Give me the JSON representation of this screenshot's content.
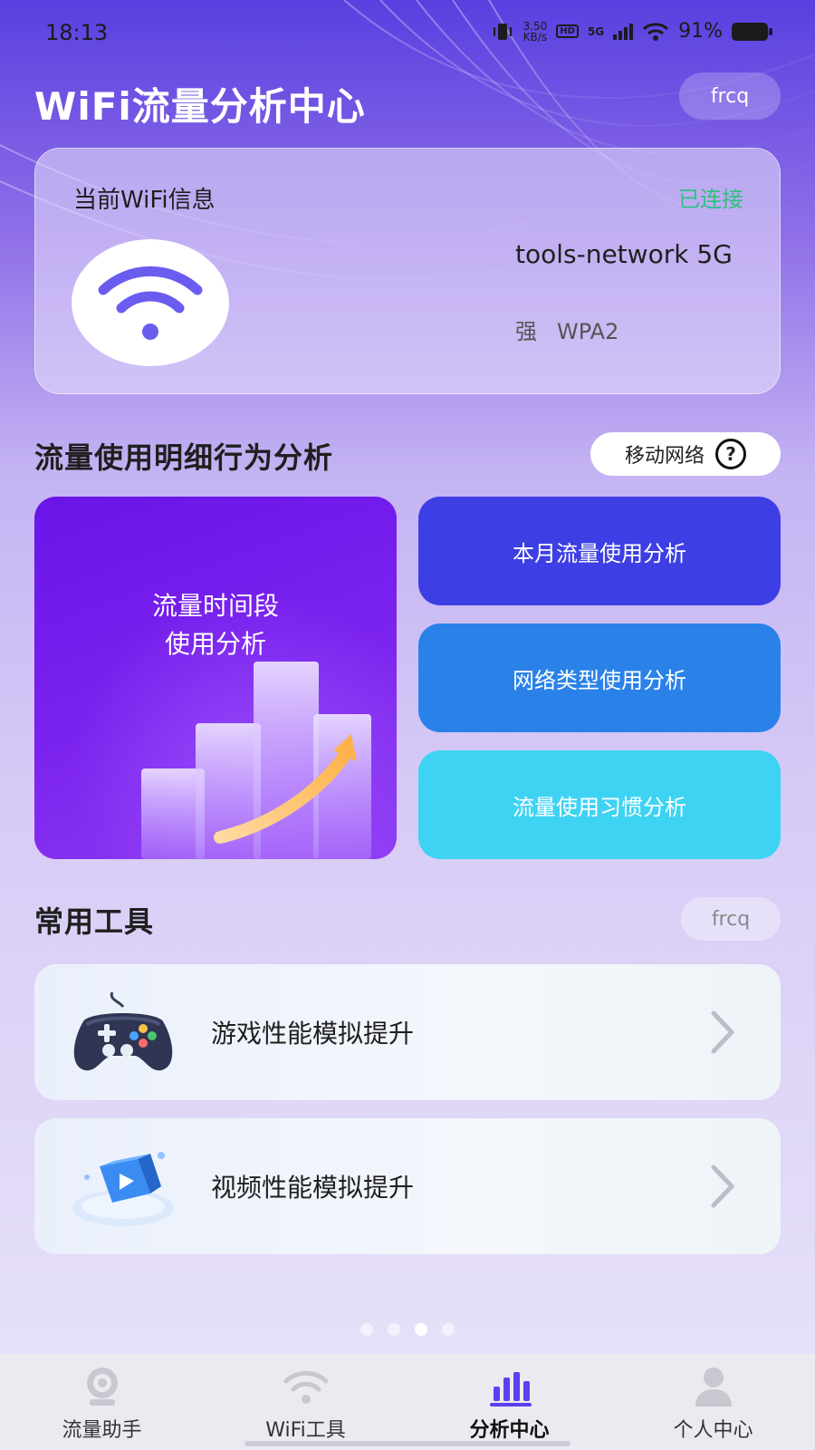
{
  "status_bar": {
    "time": "18:13",
    "speed_value": "3.50",
    "speed_unit": "KB/s",
    "hd_tag": "HD",
    "network_tag": "5G",
    "battery": "91%"
  },
  "header": {
    "title": "WiFi流量分析中心",
    "pill": "frcq"
  },
  "wifi_card": {
    "title": "当前WiFi信息",
    "status": "已连接",
    "status_color": "#2ec27e",
    "ssid": "tools-network 5G",
    "signal": "强",
    "security": "WPA2",
    "icon": "wifi-icon"
  },
  "analysis": {
    "title": "流量使用明细行为分析",
    "network_selector": "移动网络",
    "help_icon": "question-icon",
    "big_tile_label_line1": "流量时间段",
    "big_tile_label_line2": "使用分析",
    "tiles": [
      {
        "label": "本月流量使用分析",
        "color": "#3d3fe4"
      },
      {
        "label": "网络类型使用分析",
        "color": "#2a82e9"
      },
      {
        "label": "流量使用习惯分析",
        "color": "#3fd3f3"
      }
    ]
  },
  "tools": {
    "title": "常用工具",
    "pill": "frcq",
    "items": [
      {
        "label": "游戏性能模拟提升",
        "icon": "gamepad-icon"
      },
      {
        "label": "视频性能模拟提升",
        "icon": "video-play-icon"
      }
    ]
  },
  "pager": {
    "count": 4,
    "active": 3
  },
  "bottom_nav": {
    "items": [
      {
        "label": "流量助手",
        "icon": "traffic-assistant-icon"
      },
      {
        "label": "WiFi工具",
        "icon": "wifi-icon"
      },
      {
        "label": "分析中心",
        "icon": "bar-chart-icon"
      },
      {
        "label": "个人中心",
        "icon": "person-icon"
      }
    ],
    "active_index": 2,
    "active_color": "#5b3ff0"
  }
}
